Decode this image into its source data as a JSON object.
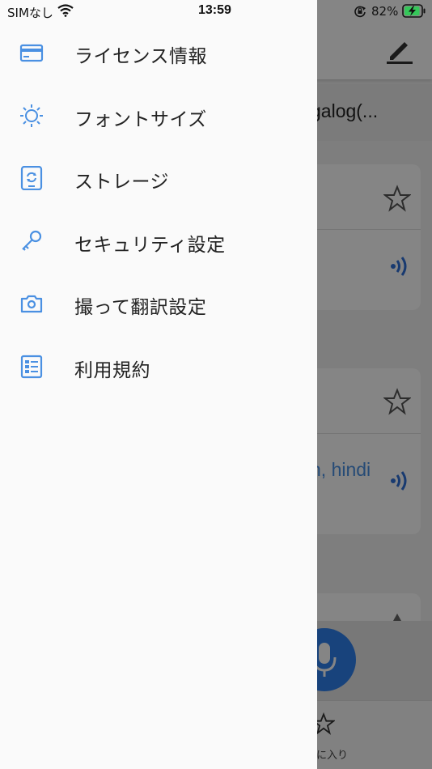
{
  "status_bar": {
    "carrier": "SIMなし",
    "time": "13:59",
    "battery_percent": "82%"
  },
  "drawer": {
    "items": [
      {
        "label": "ライセンス情報",
        "icon": "credit-card-icon"
      },
      {
        "label": "フォントサイズ",
        "icon": "brightness-icon"
      },
      {
        "label": "ストレージ",
        "icon": "tablet-sync-icon"
      },
      {
        "label": "セキュリティ設定",
        "icon": "key-icon"
      },
      {
        "label": "撮って翻訳設定",
        "icon": "camera-icon"
      },
      {
        "label": "利用規約",
        "icon": "list-document-icon"
      }
    ]
  },
  "background": {
    "language_bar": "galog(...",
    "card2_text": "n, hindi",
    "tab_favorite_label": "に入り"
  },
  "colors": {
    "accent": "#4a90e2",
    "mic_button": "#2f80ed",
    "drawer_bg": "#fafafa"
  }
}
